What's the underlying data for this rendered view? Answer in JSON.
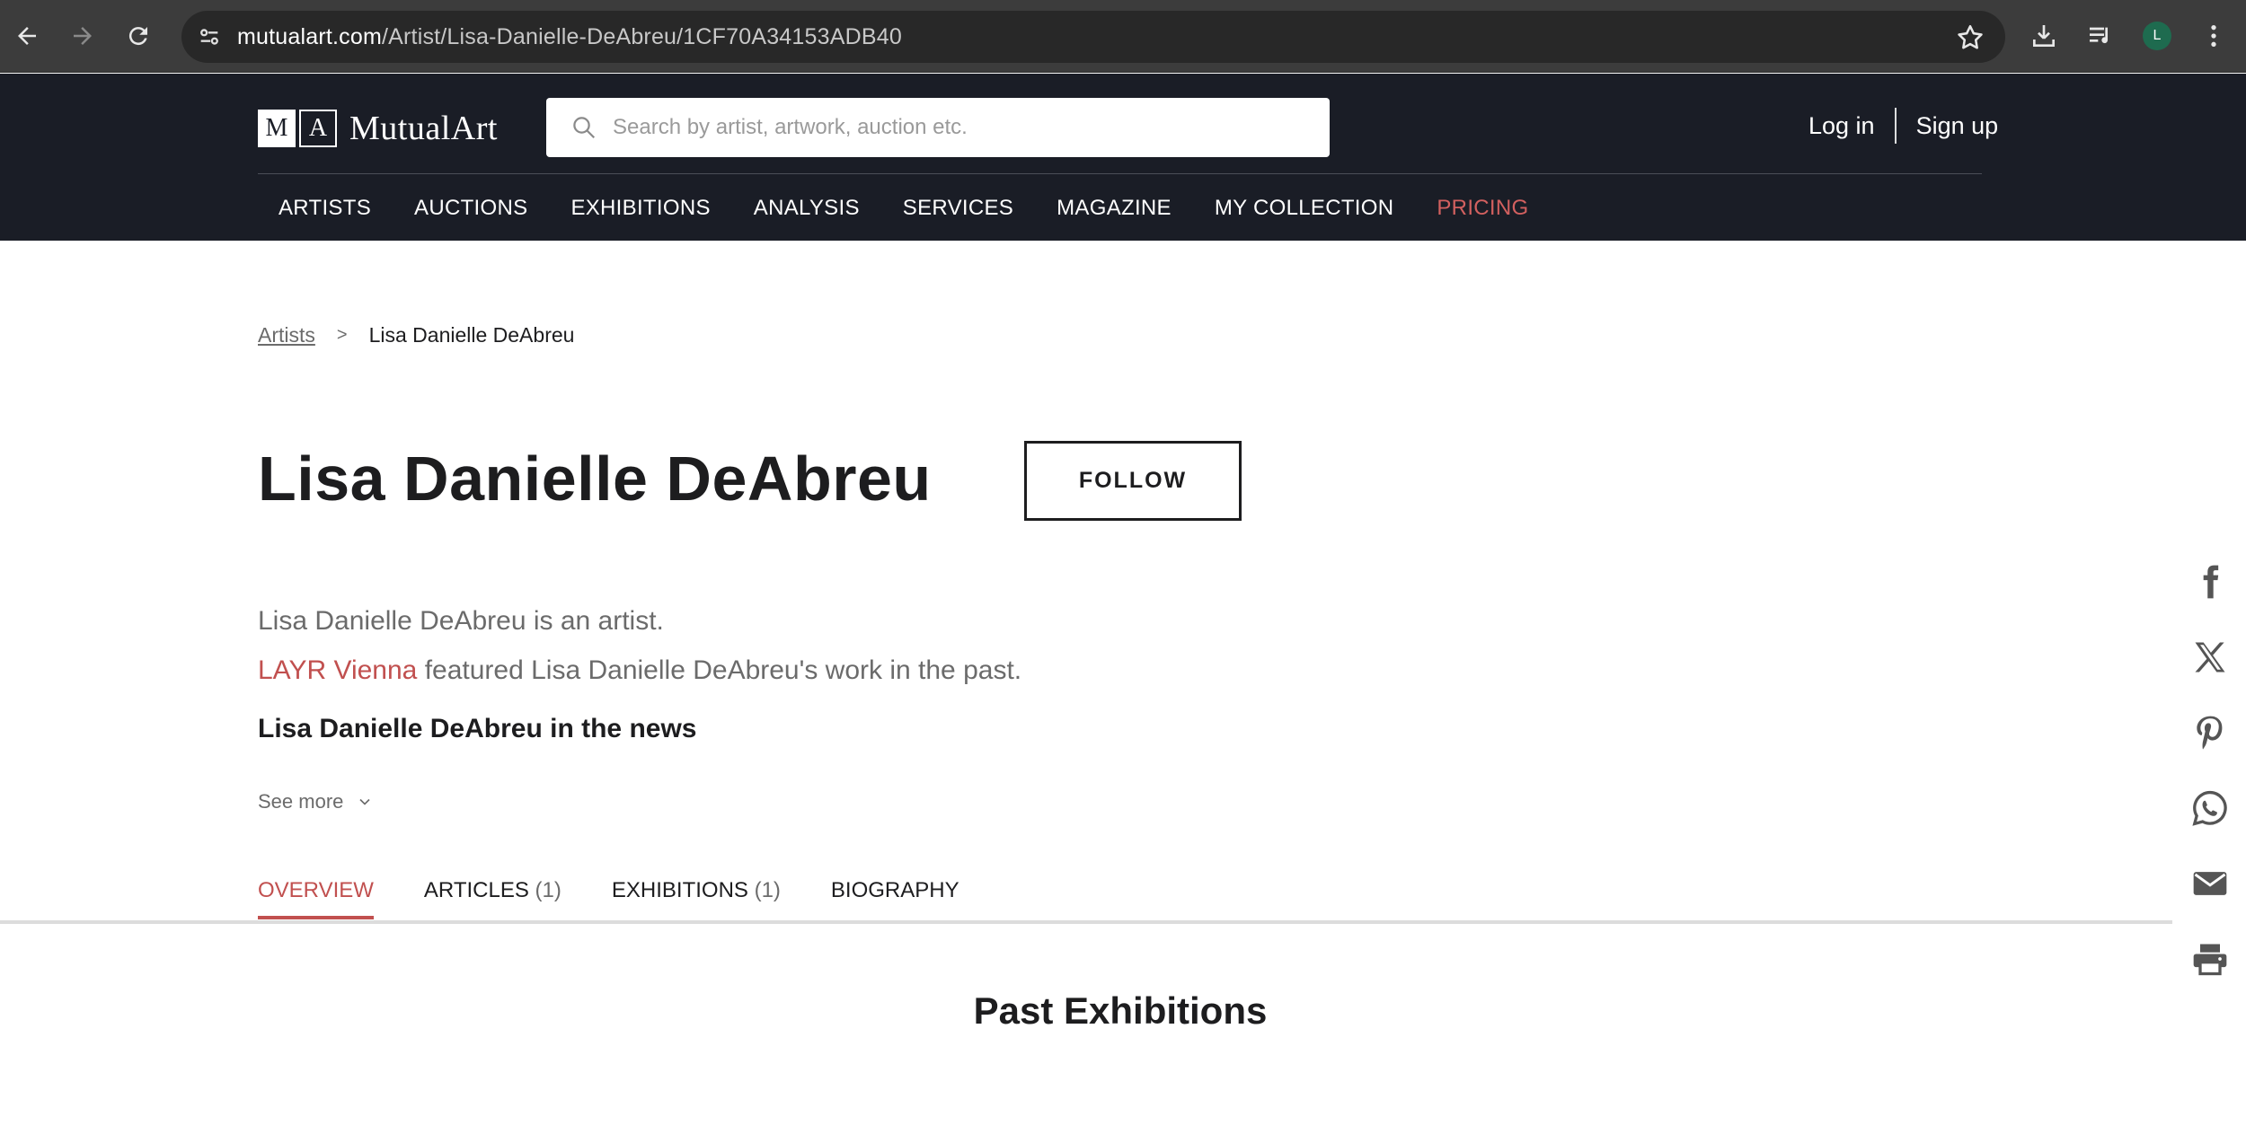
{
  "browser": {
    "url_host": "mutualart.com",
    "url_path": "/Artist/Lisa-Danielle-DeAbreu/1CF70A34153ADB40",
    "profile_initial": "L"
  },
  "header": {
    "logo_m": "M",
    "logo_a": "A",
    "logo_word": "MutualArt",
    "search_placeholder": "Search by artist, artwork, auction etc.",
    "login": "Log in",
    "signup": "Sign up"
  },
  "nav": {
    "items": [
      "ARTISTS",
      "AUCTIONS",
      "EXHIBITIONS",
      "ANALYSIS",
      "SERVICES",
      "MAGAZINE",
      "MY COLLECTION",
      "PRICING"
    ]
  },
  "breadcrumb": {
    "root": "Artists",
    "separator": ">",
    "current": "Lisa Danielle DeAbreu"
  },
  "artist": {
    "name": "Lisa Danielle DeAbreu",
    "follow_label": "FOLLOW",
    "description": "Lisa Danielle DeAbreu is an artist.",
    "gallery_link": "LAYR Vienna",
    "gallery_text": " featured Lisa Danielle DeAbreu's work in the past.",
    "news_heading": "Lisa Danielle DeAbreu in the news",
    "see_more": "See more"
  },
  "tabs": [
    {
      "label": "OVERVIEW",
      "count": ""
    },
    {
      "label": "ARTICLES",
      "count": "(1)"
    },
    {
      "label": "EXHIBITIONS",
      "count": "(1)"
    },
    {
      "label": "BIOGRAPHY",
      "count": ""
    }
  ],
  "section": {
    "title": "Past Exhibitions"
  },
  "colors": {
    "header_bg": "#1a1d26",
    "accent": "#c1504f"
  }
}
